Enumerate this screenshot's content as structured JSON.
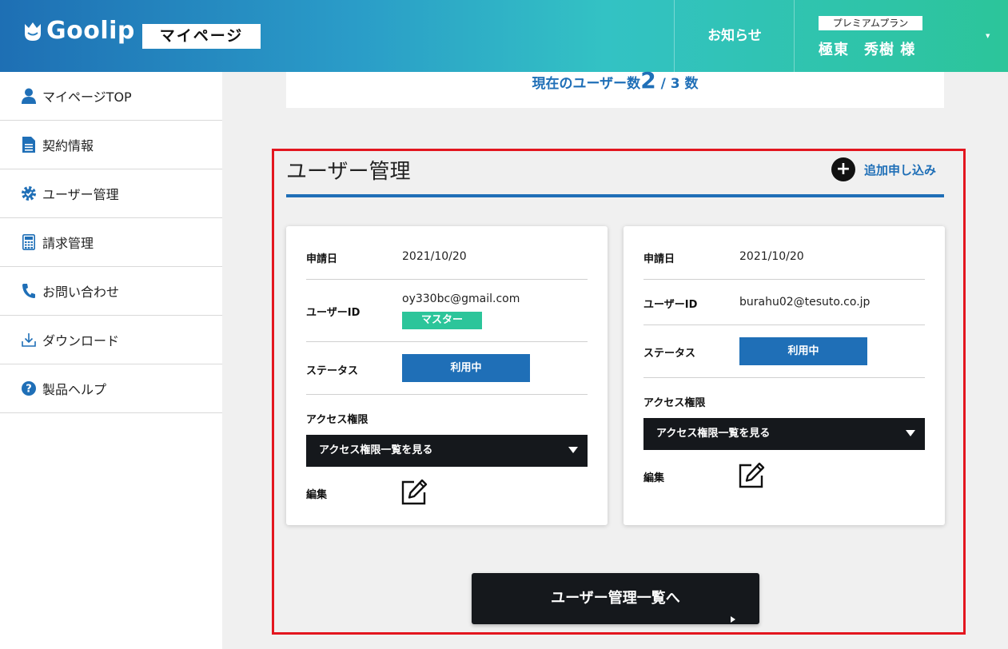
{
  "header": {
    "logo_text": "Goolip",
    "mypage_label": "マイページ",
    "notice_label": "お知らせ",
    "plan_label": "プレミアムプラン",
    "user_name": "極東　秀樹 様"
  },
  "sidebar": {
    "items": [
      {
        "label": "マイページTOP",
        "icon": "user-icon"
      },
      {
        "label": "契約情報",
        "icon": "document-icon"
      },
      {
        "label": "ユーザー管理",
        "icon": "user-gear-icon"
      },
      {
        "label": "請求管理",
        "icon": "calculator-icon"
      },
      {
        "label": "お問い合わせ",
        "icon": "phone-icon"
      },
      {
        "label": "ダウンロード",
        "icon": "download-icon"
      },
      {
        "label": "製品ヘルプ",
        "icon": "help-icon"
      }
    ]
  },
  "summary": {
    "prefix": "現在のユーザー数",
    "current": "2",
    "separator": " / ",
    "max": "3",
    "suffix": " 数"
  },
  "section": {
    "title": "ユーザー管理",
    "add_label": "追加申し込み"
  },
  "labels": {
    "apply_date": "申請日",
    "user_id": "ユーザーID",
    "status": "ステータス",
    "access": "アクセス権限",
    "edit": "編集"
  },
  "users": [
    {
      "apply_date": "2021/10/20",
      "user_id": "oy330bc@gmail.com",
      "badge": "マスター",
      "status": "利用中",
      "access_select": "アクセス権限一覧を見る"
    },
    {
      "apply_date": "2021/10/20",
      "user_id": "burahu02@tesuto.co.jp",
      "status": "利用中",
      "access_select": "アクセス権限一覧を見る"
    }
  ],
  "list_button": "ユーザー管理一覧へ",
  "colors": {
    "brand_blue": "#1f6fb7",
    "master_green": "#2cc59a",
    "dark": "#15181c",
    "highlight_red": "#e3161f"
  }
}
